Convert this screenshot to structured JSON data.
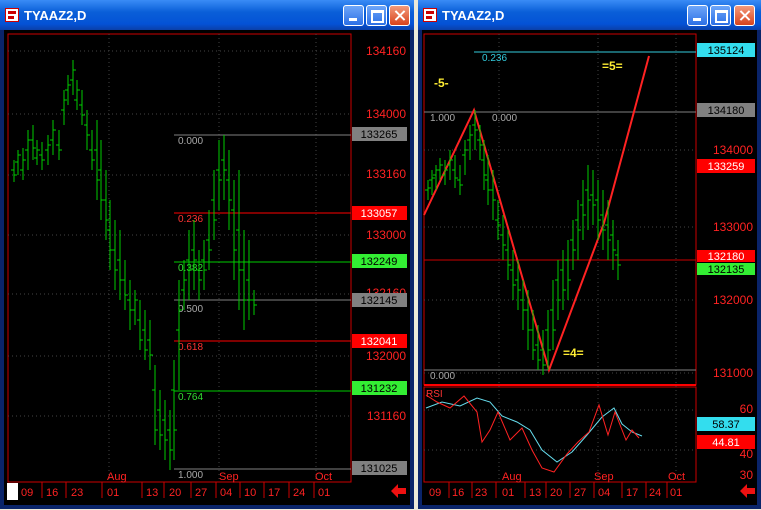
{
  "window1": {
    "title": "TYAAZ2,D",
    "price_scale": [
      "134160",
      "134000",
      "133160",
      "133000",
      "132160",
      "132000",
      "131160"
    ],
    "boxed_labels": [
      "133265",
      "133057",
      "132249",
      "132145",
      "132041",
      "131232",
      "131025"
    ],
    "fib_labels": [
      "0.000",
      "0.236",
      "0.382",
      "0.500",
      "0.618",
      "0.764",
      "1.000"
    ],
    "months": [
      "Aug",
      "Sep",
      "Oct"
    ],
    "dates": [
      "09",
      "16",
      "23",
      "01",
      "13",
      "20",
      "27",
      "04",
      "10",
      "17",
      "24",
      "01"
    ]
  },
  "window2": {
    "title": "TYAAZ2,D",
    "price_scale": [
      "134000",
      "133000",
      "132000",
      "131000"
    ],
    "boxed_labels": [
      "135124",
      "134180",
      "133259",
      "132180",
      "132135"
    ],
    "fib_labels": [
      "0.236",
      "1.000",
      "0.000",
      "0.000"
    ],
    "wave_labels": [
      "-5-",
      "=5=",
      "=4="
    ],
    "rsi": {
      "label": "RSI",
      "scale": [
        "60",
        "40",
        "30"
      ],
      "boxed": [
        "58.37",
        "44.81"
      ]
    },
    "months": [
      "Aug",
      "Sep",
      "Oct"
    ],
    "dates": [
      "09",
      "16",
      "23",
      "01",
      "13",
      "20",
      "27",
      "04",
      "17",
      "24",
      "01"
    ]
  },
  "colors": {
    "up_bar": "#00cc00",
    "fib_red": "#ff0000",
    "fib_gray": "#808080",
    "rsi_cyan": "#66ddee"
  }
}
